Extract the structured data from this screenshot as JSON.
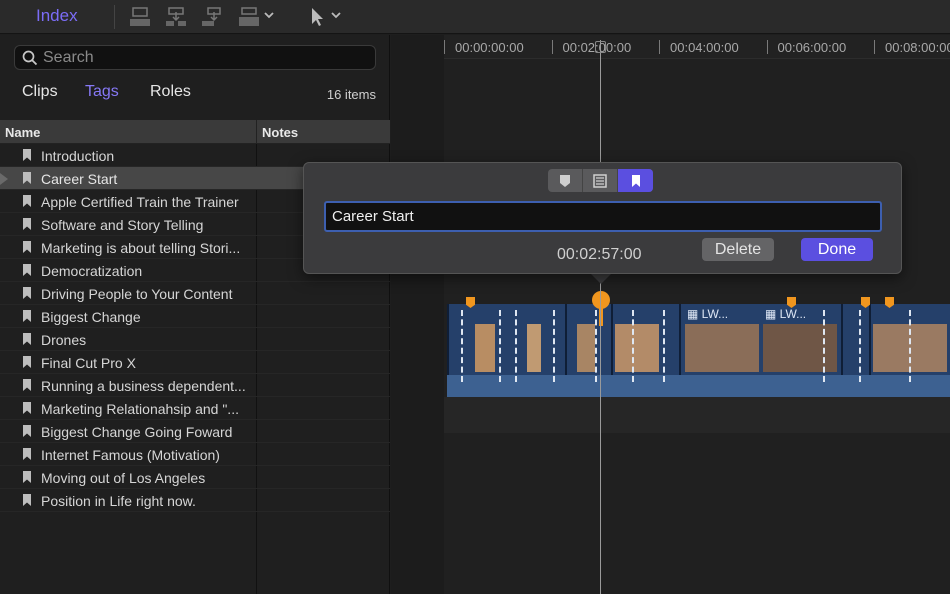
{
  "toolbar": {
    "title": "Index",
    "icons": [
      "connect-clip-icon",
      "insert-clip-icon",
      "append-clip-icon",
      "overwrite-clip-icon",
      "select-tool-icon"
    ]
  },
  "index": {
    "search_placeholder": "Search",
    "tabs": [
      {
        "label": "Clips",
        "active": false
      },
      {
        "label": "Tags",
        "active": true
      },
      {
        "label": "Roles",
        "active": false
      }
    ],
    "item_count": "16 items",
    "columns": {
      "name": "Name",
      "notes": "Notes"
    },
    "items": [
      "Introduction",
      "Career Start",
      "Apple Certified Train the Trainer",
      "Software and Story Telling",
      "Marketing is about telling Stori...",
      "Democratization",
      "Driving People to Your Content",
      "Biggest Change",
      "Drones",
      "Final Cut Pro X",
      "Running a business dependent...",
      "Marketing Relationahsip and \"...",
      "Biggest Change Going Foward",
      "Internet Famous (Motivation)",
      "Moving out of Los Angeles",
      "Position in Life right now."
    ],
    "selected_index": 1
  },
  "timeline": {
    "timecodes": [
      "00:00:00:00",
      "00:02:00:00",
      "00:04:00:00",
      "00:06:00:00",
      "00:08:00:00"
    ],
    "clip_labels": [
      "LW...",
      "LW..."
    ]
  },
  "popover": {
    "modes": [
      "marker-standard-icon",
      "marker-todo-icon",
      "marker-chapter-icon"
    ],
    "active_mode": 2,
    "name_value": "Career Start",
    "timecode": "00:02:57:00",
    "delete_label": "Delete",
    "done_label": "Done"
  },
  "colors": {
    "accent": "#5b4fe0",
    "tab_active": "#8678f5",
    "marker": "#f0961f",
    "clip": "#25406a"
  }
}
